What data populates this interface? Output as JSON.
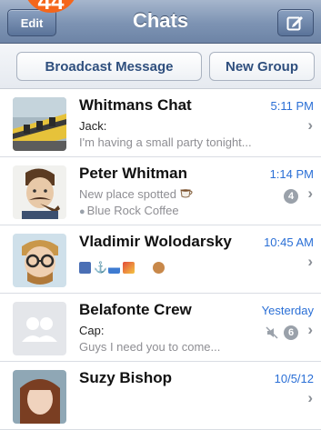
{
  "badge": {
    "number": "44"
  },
  "navbar": {
    "title": "Chats",
    "edit_label": "Edit",
    "compose_icon": "compose-icon"
  },
  "actions": {
    "broadcast_label": "Broadcast Message",
    "new_group_label": "New Group"
  },
  "chats": [
    {
      "name": "Whitmans Chat",
      "time": "5:11 PM",
      "line1": "Jack:",
      "line2": "I'm having a small party tonight..."
    },
    {
      "name": "Peter Whitman",
      "time": "1:14 PM",
      "line1": "New place spotted",
      "line2": "Blue Rock Coffee",
      "unread": "4"
    },
    {
      "name": "Vladimir Wolodarsky",
      "time": "10:45 AM"
    },
    {
      "name": "Belafonte Crew",
      "time": "Yesterday",
      "line1": "Cap:",
      "line2": "Guys I need you to come...",
      "unread": "6"
    },
    {
      "name": "Suzy Bishop",
      "time": "10/5/12"
    }
  ],
  "colors": {
    "badge": "#f5661b",
    "time": "#2a6fd6",
    "nav": "#7d93b3"
  }
}
